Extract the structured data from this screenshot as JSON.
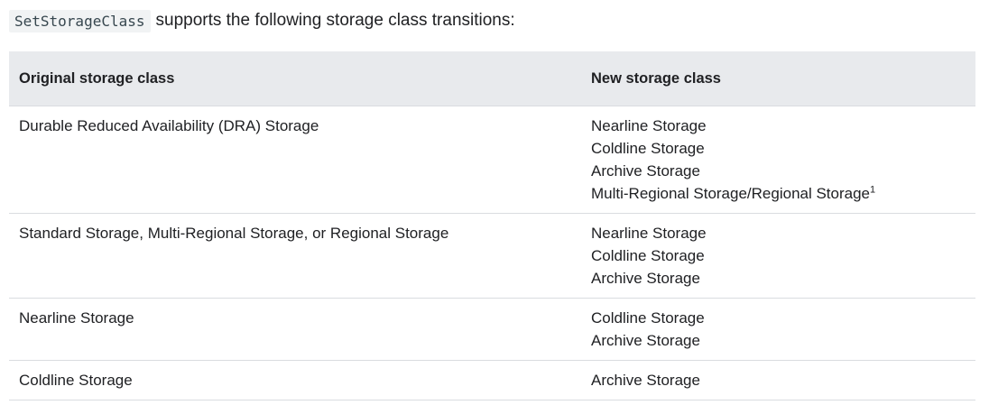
{
  "intro": {
    "code": "SetStorageClass",
    "text": "supports the following storage class transitions:"
  },
  "table": {
    "headers": {
      "original": "Original storage class",
      "new": "New storage class"
    },
    "rows": [
      {
        "original": "Durable Reduced Availability (DRA) Storage",
        "new": [
          "Nearline Storage",
          "Coldline Storage",
          "Archive Storage",
          "Multi-Regional Storage/Regional Storage"
        ],
        "footnote": "1"
      },
      {
        "original": "Standard Storage, Multi-Regional Storage, or Regional Storage",
        "new": [
          "Nearline Storage",
          "Coldline Storage",
          "Archive Storage"
        ]
      },
      {
        "original": "Nearline Storage",
        "new": [
          "Coldline Storage",
          "Archive Storage"
        ]
      },
      {
        "original": "Coldline Storage",
        "new": [
          "Archive Storage"
        ]
      }
    ]
  }
}
